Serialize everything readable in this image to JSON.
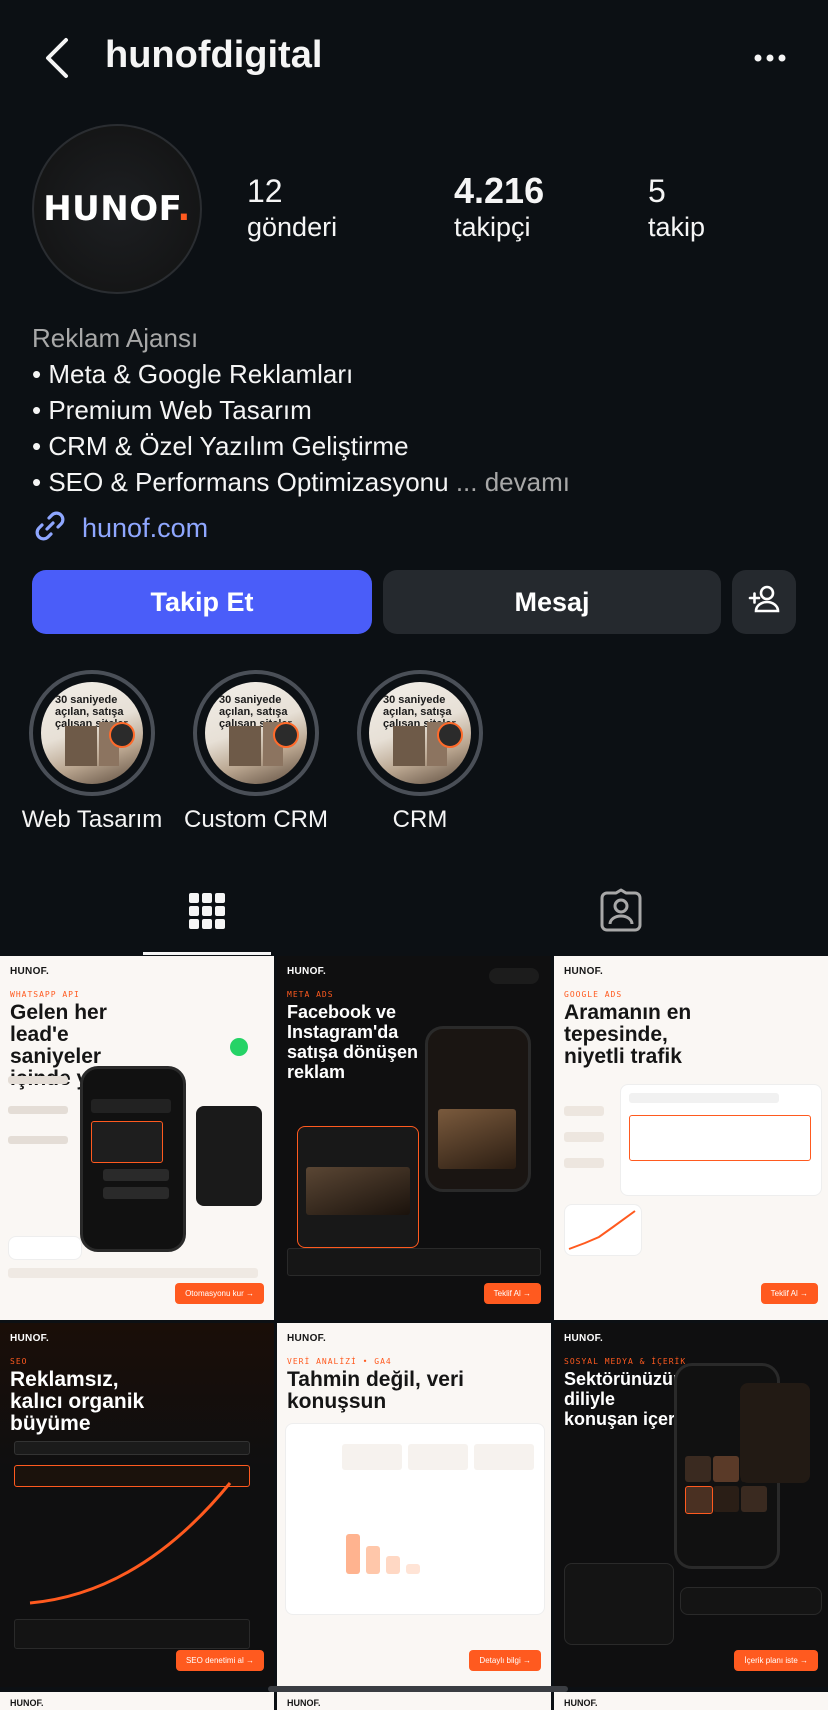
{
  "header": {
    "username": "hunofdigital"
  },
  "profile": {
    "avatar_text": "HUNOF",
    "avatar_dot": ".",
    "stats": [
      {
        "value": "12",
        "label": "gönderi"
      },
      {
        "value": "4.216",
        "label": "takipçi"
      },
      {
        "value": "5",
        "label": "takip"
      }
    ],
    "category": "Reklam Ajansı",
    "bio_lines": [
      "• Meta & Google Reklamları",
      "• Premium Web Tasarım",
      "• CRM & Özel Yazılım Geliştirme",
      "• SEO & Performans Optimizasyonu"
    ],
    "more_label": "... devamı",
    "link": "hunof.com"
  },
  "actions": {
    "follow": "Takip Et",
    "message": "Mesaj"
  },
  "highlights": [
    {
      "label": "Web Tasarım",
      "thumb_text": "30 saniyede açılan, satışa çalışan siteler"
    },
    {
      "label": "Custom CRM",
      "thumb_text": "30 saniyede açılan, satışa çalışan siteler"
    },
    {
      "label": "CRM",
      "thumb_text": "30 saniyede açılan, satışa çalışan siteler"
    }
  ],
  "posts": [
    {
      "brand": "HUNOF.",
      "tag": "WHATSAPP API",
      "headline": "Gelen her lead'e saniyeler içinde yanıt",
      "cta": "Otomasyonu kur →",
      "theme": "light"
    },
    {
      "brand": "HUNOF.",
      "tag": "META ADS",
      "headline": "Facebook ve Instagram'da satışa dönüşen reklam",
      "cta": "Teklif Al →",
      "theme": "dark"
    },
    {
      "brand": "HUNOF.",
      "tag": "GOOGLE ADS",
      "headline": "Aramanın en tepesinde, niyetli trafik",
      "cta": "Teklif Al →",
      "theme": "light"
    },
    {
      "brand": "HUNOF.",
      "tag": "SEO",
      "headline": "Reklamsız, kalıcı organik büyüme",
      "cta": "SEO denetimi al →",
      "theme": "dark"
    },
    {
      "brand": "HUNOF.",
      "tag": "VERİ ANALİZİ • GA4",
      "headline": "Tahmin değil, veri konuşsun",
      "cta": "Detaylı bilgi →",
      "theme": "light"
    },
    {
      "brand": "HUNOF.",
      "tag": "SOSYAL MEDYA & İÇERİK",
      "headline": "Sektörünüzün diliyle konuşan içerik",
      "cta": "İçerik planı iste →",
      "theme": "dark"
    }
  ],
  "bottom_row": [
    "HUNOF.",
    "HUNOF.",
    "HUNOF."
  ],
  "colors": {
    "accent": "#4a5df9",
    "brand_orange": "#ff5a1f",
    "link": "#8fa7ff",
    "bg": "#0c1014"
  }
}
